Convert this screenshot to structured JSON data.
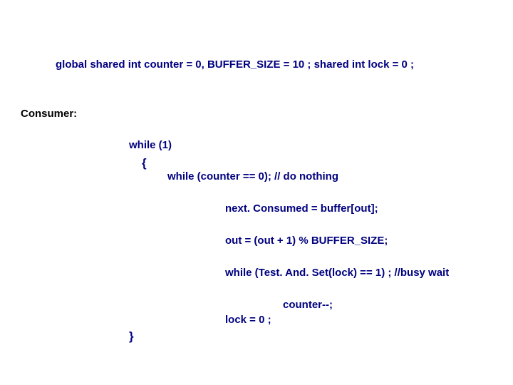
{
  "declaration": "global shared int counter = 0, BUFFER_SIZE = 10 ; shared int lock = 0 ;",
  "consumer_label": "Consumer:",
  "code": {
    "while_1": "while (1)",
    "open_brace": "{",
    "while_counter": "while (counter == 0); // do nothing",
    "next_consumed": "next. Consumed =  buffer[out];",
    "out_line": "out = (out + 1) % BUFFER_SIZE;",
    "while_test": "while (Test. And. Set(lock) == 1) ; //busy wait",
    "counter_dec": "counter--;",
    "lock_zero": "lock = 0 ;",
    "close_brace": "}"
  }
}
